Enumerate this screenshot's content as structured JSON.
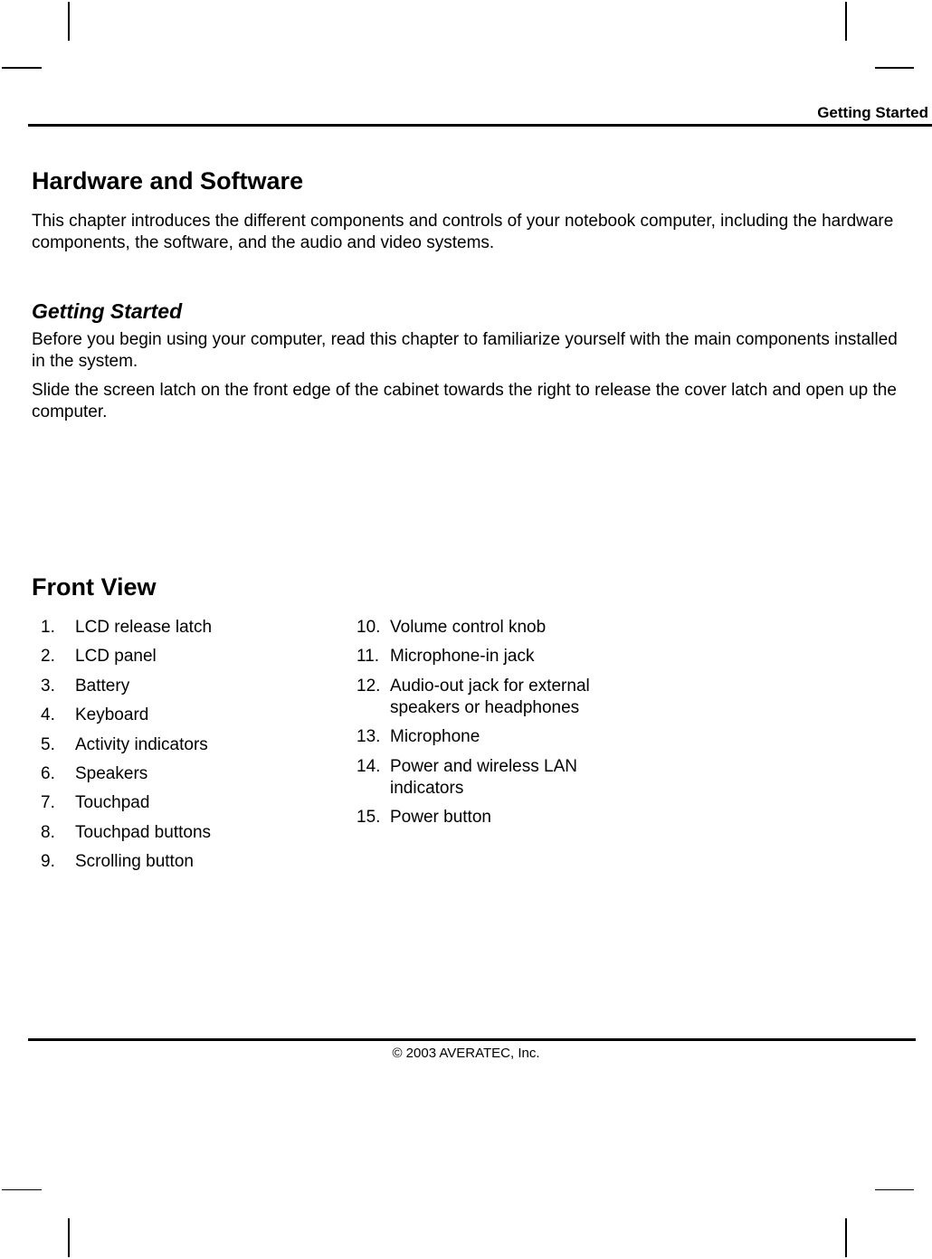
{
  "header": {
    "running_title": "Getting Started"
  },
  "main": {
    "title": "Hardware and Software",
    "intro": "This chapter introduces the different components and controls of your notebook computer, including the hardware components, the software, and the audio and video systems.",
    "section": {
      "title": "Getting Started",
      "paragraphs": [
        "Before you begin using your computer, read this chapter to familiarize yourself with the main components installed in the system.",
        "Slide the screen latch on the front edge of the cabinet towards the right to release the cover latch and open up the computer."
      ]
    },
    "front_view": {
      "title": "Front View",
      "left_items": [
        {
          "num": "1.",
          "label": "LCD release latch"
        },
        {
          "num": "2.",
          "label": "LCD panel"
        },
        {
          "num": "3.",
          "label": "Battery"
        },
        {
          "num": "4.",
          "label": "Keyboard"
        },
        {
          "num": "5.",
          "label": "Activity indicators"
        },
        {
          "num": "6.",
          "label": "Speakers"
        },
        {
          "num": "7.",
          "label": "Touchpad"
        },
        {
          "num": "8.",
          "label": "Touchpad buttons"
        },
        {
          "num": "9.",
          "label": "Scrolling button"
        }
      ],
      "right_items": [
        {
          "num": "10.",
          "label": "Volume control knob"
        },
        {
          "num": "11.",
          "label": "Microphone-in jack"
        },
        {
          "num": "12.",
          "label": "Audio-out jack for external speakers or headphones"
        },
        {
          "num": "13.",
          "label": "Microphone"
        },
        {
          "num": "14.",
          "label": "Power and wireless LAN indicators"
        },
        {
          "num": "15.",
          "label": "Power button"
        }
      ]
    }
  },
  "footer": {
    "copyright": "© 2003 AVERATEC, Inc."
  }
}
